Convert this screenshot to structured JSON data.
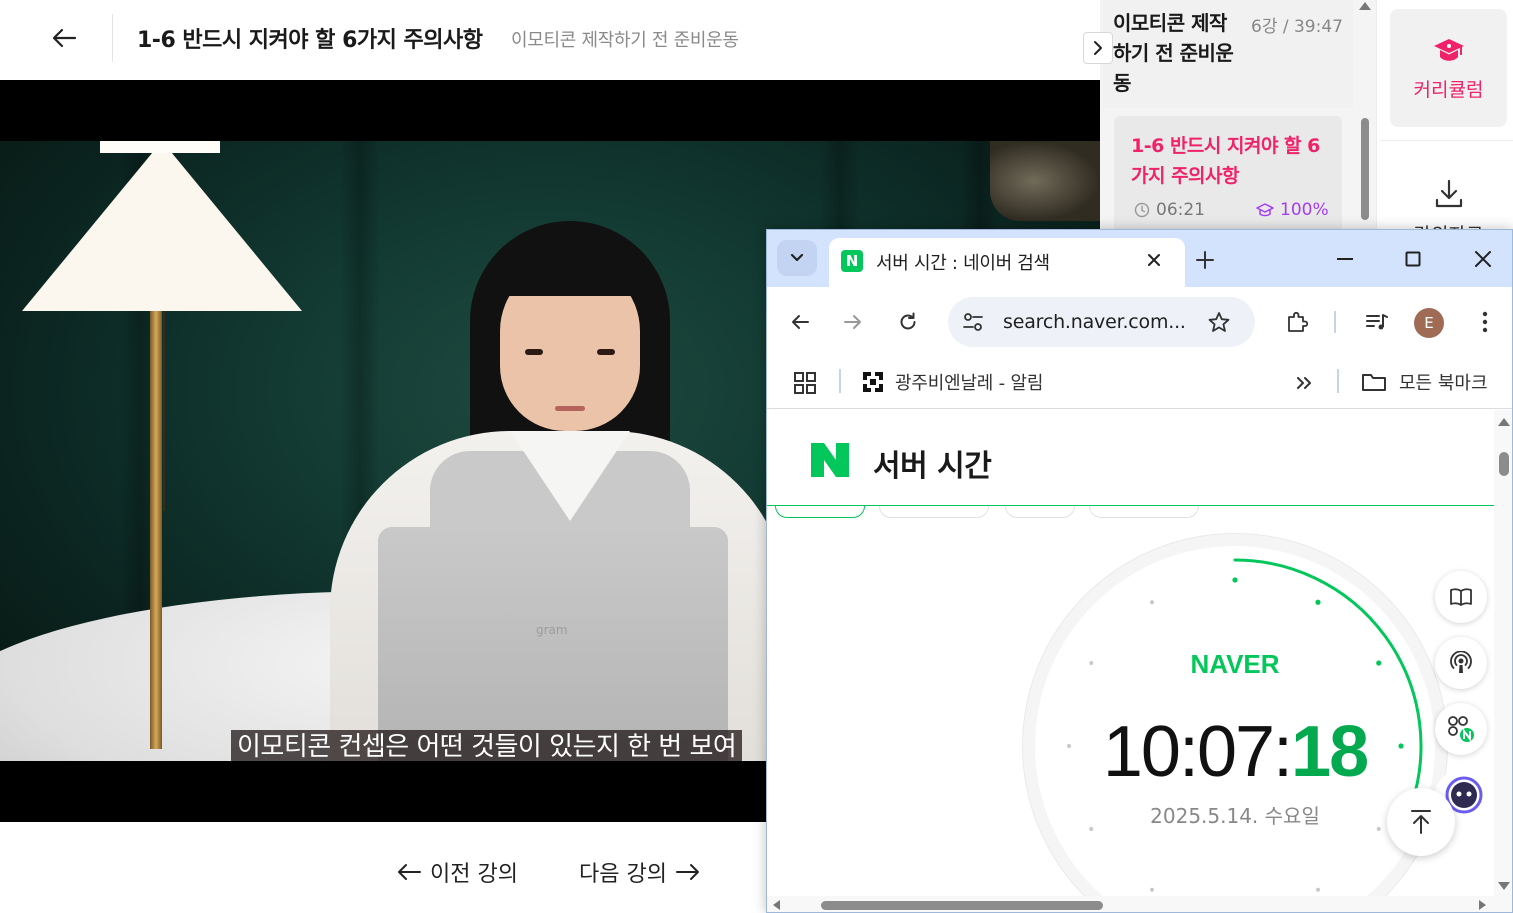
{
  "player": {
    "lecture_title": "1-6 반드시 지켜야 할 6가지 주의사항",
    "lecture_subtitle": "이모티콘 제작하기 전 준비운동",
    "video_caption": "이모티콘 컨셉은 어떤 것들이 있는지 한 번 보여",
    "laptop_brand": "gram",
    "prev_label": "이전 강의",
    "next_label": "다음 강의"
  },
  "side_panel": {
    "chapter_title": "이모티콘 제작하기 전 준비운동",
    "chapter_meta": "6강 / 39:47",
    "lesson": {
      "title": "1-6 반드시 지켜야 할 6가지 주의사항",
      "duration": "06:21",
      "progress": "100%",
      "progress_value": 1.0
    }
  },
  "rail": {
    "curriculum_label": "커리큘럼",
    "download_label": "강의자료"
  },
  "browser": {
    "tab_title": "서버 시간 : 네이버 검색",
    "tab_favicon": "N",
    "url": "search.naver.com...",
    "profile_initial": "E",
    "bookmark_item": "광주비엔날레 - 알림",
    "all_bookmarks": "모든 북마크"
  },
  "naver": {
    "section_title": "서버 시간",
    "clock_brand": "NAVER",
    "time_hm": "10:07:",
    "time_sec": "18",
    "date": "2025.5.14. 수요일",
    "seconds_elapsed": 18
  },
  "colors": {
    "accent_pink": "#f0236a",
    "progress_purple": "#a53cf0",
    "naver_green": "#03c75a",
    "chrome_tabstrip": "#d3e3fd"
  },
  "icons": {
    "back": "arrow-left-icon",
    "collapse": "chevron-right-icon",
    "curriculum": "graduation-cap-icon",
    "download": "download-icon",
    "clock": "clock-icon",
    "progress": "graduation-cap-small-icon",
    "reader": "book-open-icon",
    "podcast": "podcast-icon",
    "apps_naver": "apps-n-icon",
    "assistant": "assistant-face-icon",
    "scroll_top": "arrow-up-icon"
  }
}
